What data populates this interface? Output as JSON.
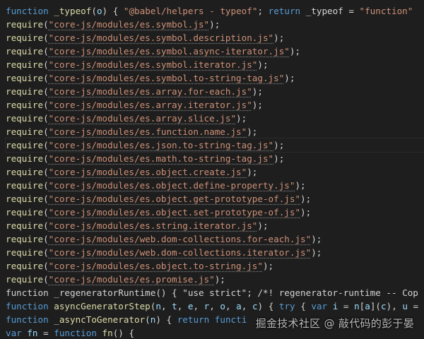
{
  "editor": {
    "lines": [
      [
        {
          "t": "function",
          "c": "kw"
        },
        {
          "t": " ",
          "c": "plain"
        },
        {
          "t": "_typeof",
          "c": "fn"
        },
        {
          "t": "(",
          "c": "plain"
        },
        {
          "t": "o",
          "c": "var"
        },
        {
          "t": ") { ",
          "c": "plain"
        },
        {
          "t": "\"@babel/helpers - typeof\"",
          "c": "str"
        },
        {
          "t": "; ",
          "c": "plain"
        },
        {
          "t": "return",
          "c": "kw"
        },
        {
          "t": " _typeof = ",
          "c": "plain"
        },
        {
          "t": "\"function\"",
          "c": "str"
        }
      ],
      [
        {
          "t": "require",
          "c": "fn"
        },
        {
          "t": "(",
          "c": "plain"
        },
        {
          "t": "\"core-js/modules/es.symbol.js\"",
          "c": "str",
          "u": true
        },
        {
          "t": ");",
          "c": "plain"
        }
      ],
      [
        {
          "t": "require",
          "c": "fn"
        },
        {
          "t": "(",
          "c": "plain"
        },
        {
          "t": "\"core-js/modules/es.symbol.description.js\"",
          "c": "str",
          "u": true
        },
        {
          "t": ");",
          "c": "plain"
        }
      ],
      [
        {
          "t": "require",
          "c": "fn"
        },
        {
          "t": "(",
          "c": "plain"
        },
        {
          "t": "\"core-js/modules/es.symbol.async-iterator.js\"",
          "c": "str",
          "u": true
        },
        {
          "t": ");",
          "c": "plain"
        }
      ],
      [
        {
          "t": "require",
          "c": "fn"
        },
        {
          "t": "(",
          "c": "plain"
        },
        {
          "t": "\"core-js/modules/es.symbol.iterator.js\"",
          "c": "str",
          "u": true
        },
        {
          "t": ");",
          "c": "plain"
        }
      ],
      [
        {
          "t": "require",
          "c": "fn"
        },
        {
          "t": "(",
          "c": "plain"
        },
        {
          "t": "\"core-js/modules/es.symbol.to-string-tag.js\"",
          "c": "str",
          "u": true
        },
        {
          "t": ");",
          "c": "plain"
        }
      ],
      [
        {
          "t": "require",
          "c": "fn"
        },
        {
          "t": "(",
          "c": "plain"
        },
        {
          "t": "\"core-js/modules/es.array.for-each.js\"",
          "c": "str",
          "u": true
        },
        {
          "t": ");",
          "c": "plain"
        }
      ],
      [
        {
          "t": "require",
          "c": "fn"
        },
        {
          "t": "(",
          "c": "plain"
        },
        {
          "t": "\"core-js/modules/es.array.iterator.js\"",
          "c": "str",
          "u": true
        },
        {
          "t": ");",
          "c": "plain"
        }
      ],
      [
        {
          "t": "require",
          "c": "fn"
        },
        {
          "t": "(",
          "c": "plain"
        },
        {
          "t": "\"core-js/modules/es.array.slice.js\"",
          "c": "str",
          "u": true
        },
        {
          "t": ");",
          "c": "plain"
        }
      ],
      [
        {
          "t": "require",
          "c": "fn"
        },
        {
          "t": "(",
          "c": "plain"
        },
        {
          "t": "\"core-js/modules/es.function.name.js\"",
          "c": "str",
          "u": true
        },
        {
          "t": ");",
          "c": "plain"
        }
      ],
      [
        {
          "t": "require",
          "c": "fn"
        },
        {
          "t": "(",
          "c": "plain"
        },
        {
          "t": "\"core-js/modules/es.json.to-string-tag.js\"",
          "c": "str",
          "u": true
        },
        {
          "t": ");",
          "c": "plain"
        }
      ],
      [
        {
          "t": "require",
          "c": "fn"
        },
        {
          "t": "(",
          "c": "plain"
        },
        {
          "t": "\"core-js/modules/es.math.to-string-tag.js\"",
          "c": "str",
          "u": true
        },
        {
          "t": ");",
          "c": "plain"
        }
      ],
      [
        {
          "t": "require",
          "c": "fn"
        },
        {
          "t": "(",
          "c": "plain"
        },
        {
          "t": "\"core-js/modules/es.object.create.js\"",
          "c": "str",
          "u": true
        },
        {
          "t": ");",
          "c": "plain"
        }
      ],
      [
        {
          "t": "require",
          "c": "fn"
        },
        {
          "t": "(",
          "c": "plain"
        },
        {
          "t": "\"core-js/modules/es.object.define-property.js\"",
          "c": "str",
          "u": true
        },
        {
          "t": ");",
          "c": "plain"
        }
      ],
      [
        {
          "t": "require",
          "c": "fn"
        },
        {
          "t": "(",
          "c": "plain"
        },
        {
          "t": "\"core-js/modules/es.object.get-prototype-of.js\"",
          "c": "str",
          "u": true
        },
        {
          "t": ");",
          "c": "plain"
        }
      ],
      [
        {
          "t": "require",
          "c": "fn"
        },
        {
          "t": "(",
          "c": "plain"
        },
        {
          "t": "\"core-js/modules/es.object.set-prototype-of.js\"",
          "c": "str",
          "u": true
        },
        {
          "t": ");",
          "c": "plain"
        }
      ],
      [
        {
          "t": "require",
          "c": "fn"
        },
        {
          "t": "(",
          "c": "plain"
        },
        {
          "t": "\"core-js/modules/es.string.iterator.js\"",
          "c": "str",
          "u": true
        },
        {
          "t": ");",
          "c": "plain"
        }
      ],
      [
        {
          "t": "require",
          "c": "fn"
        },
        {
          "t": "(",
          "c": "plain"
        },
        {
          "t": "\"core-js/modules/web.dom-collections.for-each.js\"",
          "c": "str",
          "u": true
        },
        {
          "t": ");",
          "c": "plain"
        }
      ],
      [
        {
          "t": "require",
          "c": "fn"
        },
        {
          "t": "(",
          "c": "plain"
        },
        {
          "t": "\"core-js/modules/web.dom-collections.iterator.js\"",
          "c": "str",
          "u": true
        },
        {
          "t": ");",
          "c": "plain"
        }
      ],
      [
        {
          "t": "require",
          "c": "fn"
        },
        {
          "t": "(",
          "c": "plain"
        },
        {
          "t": "\"core-js/modules/es.object.to-string.js\"",
          "c": "str",
          "u": true
        },
        {
          "t": ");",
          "c": "plain"
        }
      ],
      [
        {
          "t": "require",
          "c": "fn"
        },
        {
          "t": "(",
          "c": "plain"
        },
        {
          "t": "\"core-js/modules/es.promise.js\"",
          "c": "str",
          "u": true
        },
        {
          "t": ");",
          "c": "plain"
        }
      ],
      [
        {
          "t": "function",
          "c": "plain"
        },
        {
          "t": " _regeneratorRuntime() { ",
          "c": "plain"
        },
        {
          "t": "\"use strict\"",
          "c": "plain"
        },
        {
          "t": "; /*! regenerator-runtime -- Cop",
          "c": "plain"
        }
      ],
      [
        {
          "t": "function",
          "c": "kw"
        },
        {
          "t": " ",
          "c": "plain"
        },
        {
          "t": "asyncGeneratorStep",
          "c": "fn"
        },
        {
          "t": "(",
          "c": "plain"
        },
        {
          "t": "n",
          "c": "var"
        },
        {
          "t": ", ",
          "c": "plain"
        },
        {
          "t": "t",
          "c": "var"
        },
        {
          "t": ", ",
          "c": "plain"
        },
        {
          "t": "e",
          "c": "var"
        },
        {
          "t": ", ",
          "c": "plain"
        },
        {
          "t": "r",
          "c": "var"
        },
        {
          "t": ", ",
          "c": "plain"
        },
        {
          "t": "o",
          "c": "var"
        },
        {
          "t": ", ",
          "c": "plain"
        },
        {
          "t": "a",
          "c": "var"
        },
        {
          "t": ", ",
          "c": "plain"
        },
        {
          "t": "c",
          "c": "var"
        },
        {
          "t": ") { ",
          "c": "plain"
        },
        {
          "t": "try",
          "c": "kw"
        },
        {
          "t": " { ",
          "c": "plain"
        },
        {
          "t": "var",
          "c": "kw"
        },
        {
          "t": " ",
          "c": "plain"
        },
        {
          "t": "i",
          "c": "var"
        },
        {
          "t": " = ",
          "c": "plain"
        },
        {
          "t": "n",
          "c": "var"
        },
        {
          "t": "[",
          "c": "plain"
        },
        {
          "t": "a",
          "c": "var"
        },
        {
          "t": "](",
          "c": "plain"
        },
        {
          "t": "c",
          "c": "var"
        },
        {
          "t": "), ",
          "c": "plain"
        },
        {
          "t": "u",
          "c": "var"
        },
        {
          "t": " =",
          "c": "plain"
        }
      ],
      [
        {
          "t": "function",
          "c": "kw"
        },
        {
          "t": " ",
          "c": "plain"
        },
        {
          "t": "_asyncToGenerator",
          "c": "fn"
        },
        {
          "t": "(",
          "c": "plain"
        },
        {
          "t": "n",
          "c": "var"
        },
        {
          "t": ") { ",
          "c": "plain"
        },
        {
          "t": "return",
          "c": "kw"
        },
        {
          "t": " ",
          "c": "plain"
        },
        {
          "t": "functi",
          "c": "kw"
        }
      ],
      [
        {
          "t": "var",
          "c": "kw"
        },
        {
          "t": " ",
          "c": "plain"
        },
        {
          "t": "fn",
          "c": "var"
        },
        {
          "t": " = ",
          "c": "plain"
        },
        {
          "t": "function",
          "c": "kw"
        },
        {
          "t": " ",
          "c": "plain"
        },
        {
          "t": "fn",
          "c": "fn"
        },
        {
          "t": "() {",
          "c": "plain"
        }
      ]
    ]
  },
  "watermark": {
    "text": "掘金技术社区 @ 敲代码的彭于晏"
  },
  "colors": {
    "background": "#1e1e1e",
    "keyword": "#569cd6",
    "function": "#dcdcaa",
    "string": "#ce9178",
    "variable": "#9cdcfe",
    "text": "#d4d4d4"
  }
}
